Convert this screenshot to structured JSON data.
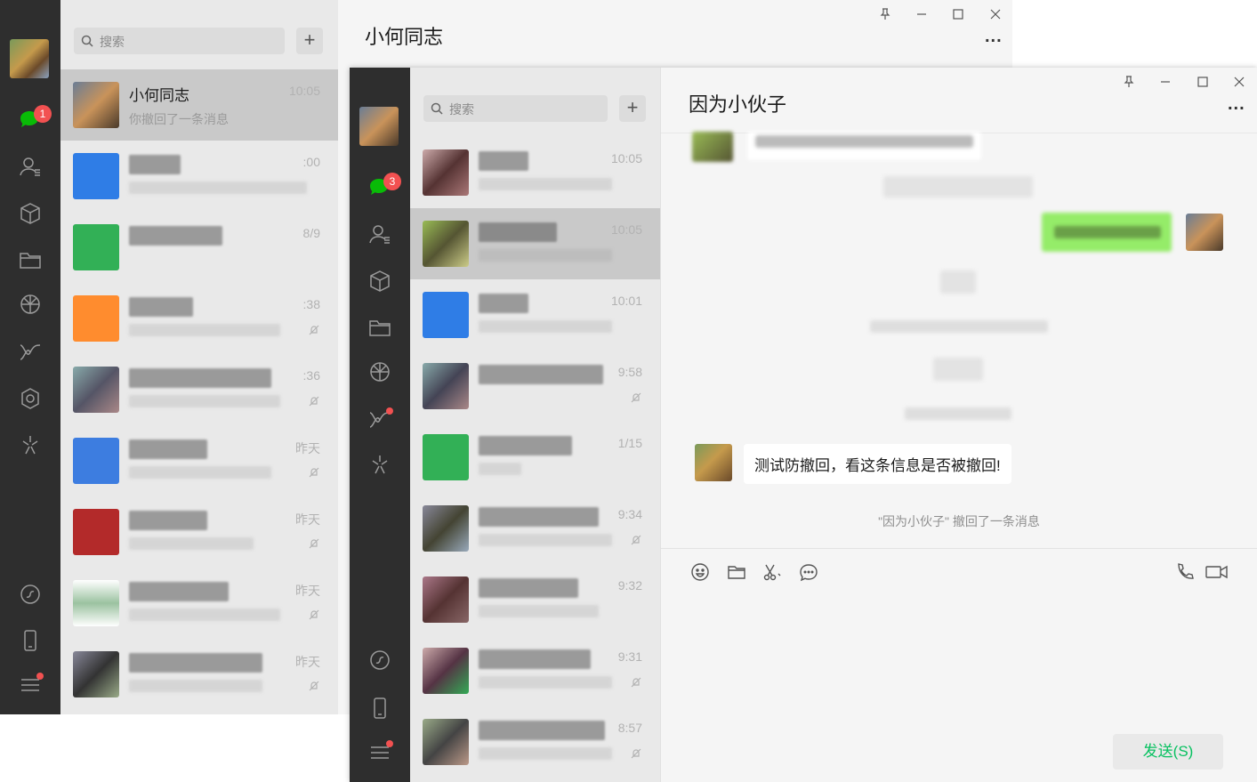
{
  "colors": {
    "sidebar": "#2e2e2e",
    "list_bg": "#e9e9e9",
    "chat_bg": "#f5f5f5",
    "badge": "#f25151",
    "bubble_out": "#95ec69",
    "send_text": "#07c160"
  },
  "window1": {
    "title": "小何同志",
    "search_placeholder": "搜索",
    "add_label": "+",
    "unread_badge": "1",
    "more_label": "...",
    "items": [
      {
        "name": "小何同志",
        "preview": "你撤回了一条消息",
        "time": "10:05"
      },
      {
        "time": ":00"
      },
      {
        "time": "8/9"
      },
      {
        "time": ":38"
      },
      {
        "time": ":36"
      },
      {
        "time": "昨天"
      },
      {
        "time": "昨天"
      },
      {
        "time": "昨天"
      },
      {
        "time": "昨天"
      }
    ]
  },
  "window2": {
    "title": "因为小伙子",
    "search_placeholder": "搜索",
    "add_label": "+",
    "unread_badge": "3",
    "more_label": "...",
    "items": [
      {
        "time": "10:05"
      },
      {
        "time": "10:05"
      },
      {
        "time": "10:01"
      },
      {
        "time": "9:58"
      },
      {
        "time": "1/15"
      },
      {
        "time": "9:34"
      },
      {
        "time": "9:32"
      },
      {
        "time": "9:31"
      },
      {
        "time": "8:57"
      }
    ],
    "incoming_message": "测试防撤回，看这条信息是否被撤回!",
    "recall_notice": "\"因为小伙子\" 撤回了一条消息",
    "send_button": "发送(S)"
  }
}
